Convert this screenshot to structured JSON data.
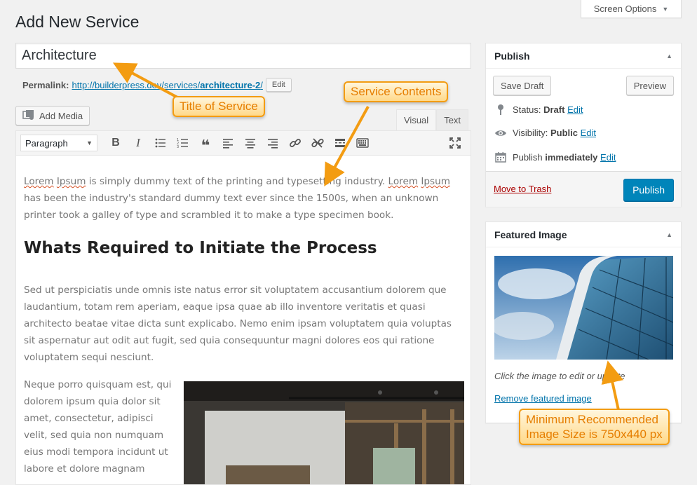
{
  "page": {
    "title": "Add New Service"
  },
  "screen_options": {
    "label": "Screen Options"
  },
  "post": {
    "title_value": "Architecture",
    "permalink_label": "Permalink:",
    "permalink_base": "http://builderpress.dev/services/",
    "permalink_slug": "architecture-2",
    "permalink_trail": "/",
    "edit_label": "Edit"
  },
  "editor": {
    "add_media_label": "Add Media",
    "tabs": [
      {
        "label": "Visual",
        "active": true
      },
      {
        "label": "Text",
        "active": false
      }
    ],
    "format_value": "Paragraph",
    "content": {
      "p1_w1": "Lorem",
      "p1_w2": "Ipsum",
      "p1_mid": " is simply dummy text of the printing and typesetting industry. ",
      "p1_w3": "Lorem",
      "p1_w4": "Ipsum",
      "p1_end": " has been the industry's standard dummy text ever since the 1500s, when an unknown printer took a galley of type and scrambled it to make a type specimen book.",
      "heading": "Whats Required to Initiate the Process",
      "p2": "Sed ut perspiciatis unde omnis iste natus error sit voluptatem accusantium dolorem que laudantium, totam rem aperiam, eaque ipsa quae ab illo inventore veritatis et quasi architecto beatae vitae dicta sunt explicabo. Nemo enim ipsam voluptatem quia voluptas sit aspernatur aut odit aut fugit, sed quia consequuntur magni dolores eos qui ratione voluptatem sequi nesciunt.",
      "p3": "Neque porro quisquam est, qui dolorem ipsum quia dolor sit amet, consectetur, adipisci velit, sed quia non numquam eius modi tempora incidunt ut labore et dolore magnam"
    }
  },
  "publish": {
    "title": "Publish",
    "save_draft": "Save Draft",
    "preview": "Preview",
    "status_label": "Status:",
    "status_value": "Draft",
    "visibility_label": "Visibility:",
    "visibility_value": "Public",
    "publish_label": "Publish",
    "publish_value": "immediately",
    "edit": "Edit",
    "trash": "Move to Trash",
    "publish_button": "Publish"
  },
  "featured_image": {
    "title": "Featured Image",
    "hint": "Click the image to edit or update",
    "remove": "Remove featured image"
  },
  "callouts": {
    "title_of_service": "Title of Service",
    "service_contents": "Service Contents",
    "image_size_line1": "Minimum Recommended",
    "image_size_line2": "Image Size is 750x440 px"
  },
  "colors": {
    "accent": "#0085ba",
    "link": "#0073aa",
    "trash": "#a00",
    "callout_border": "#f39c12"
  }
}
